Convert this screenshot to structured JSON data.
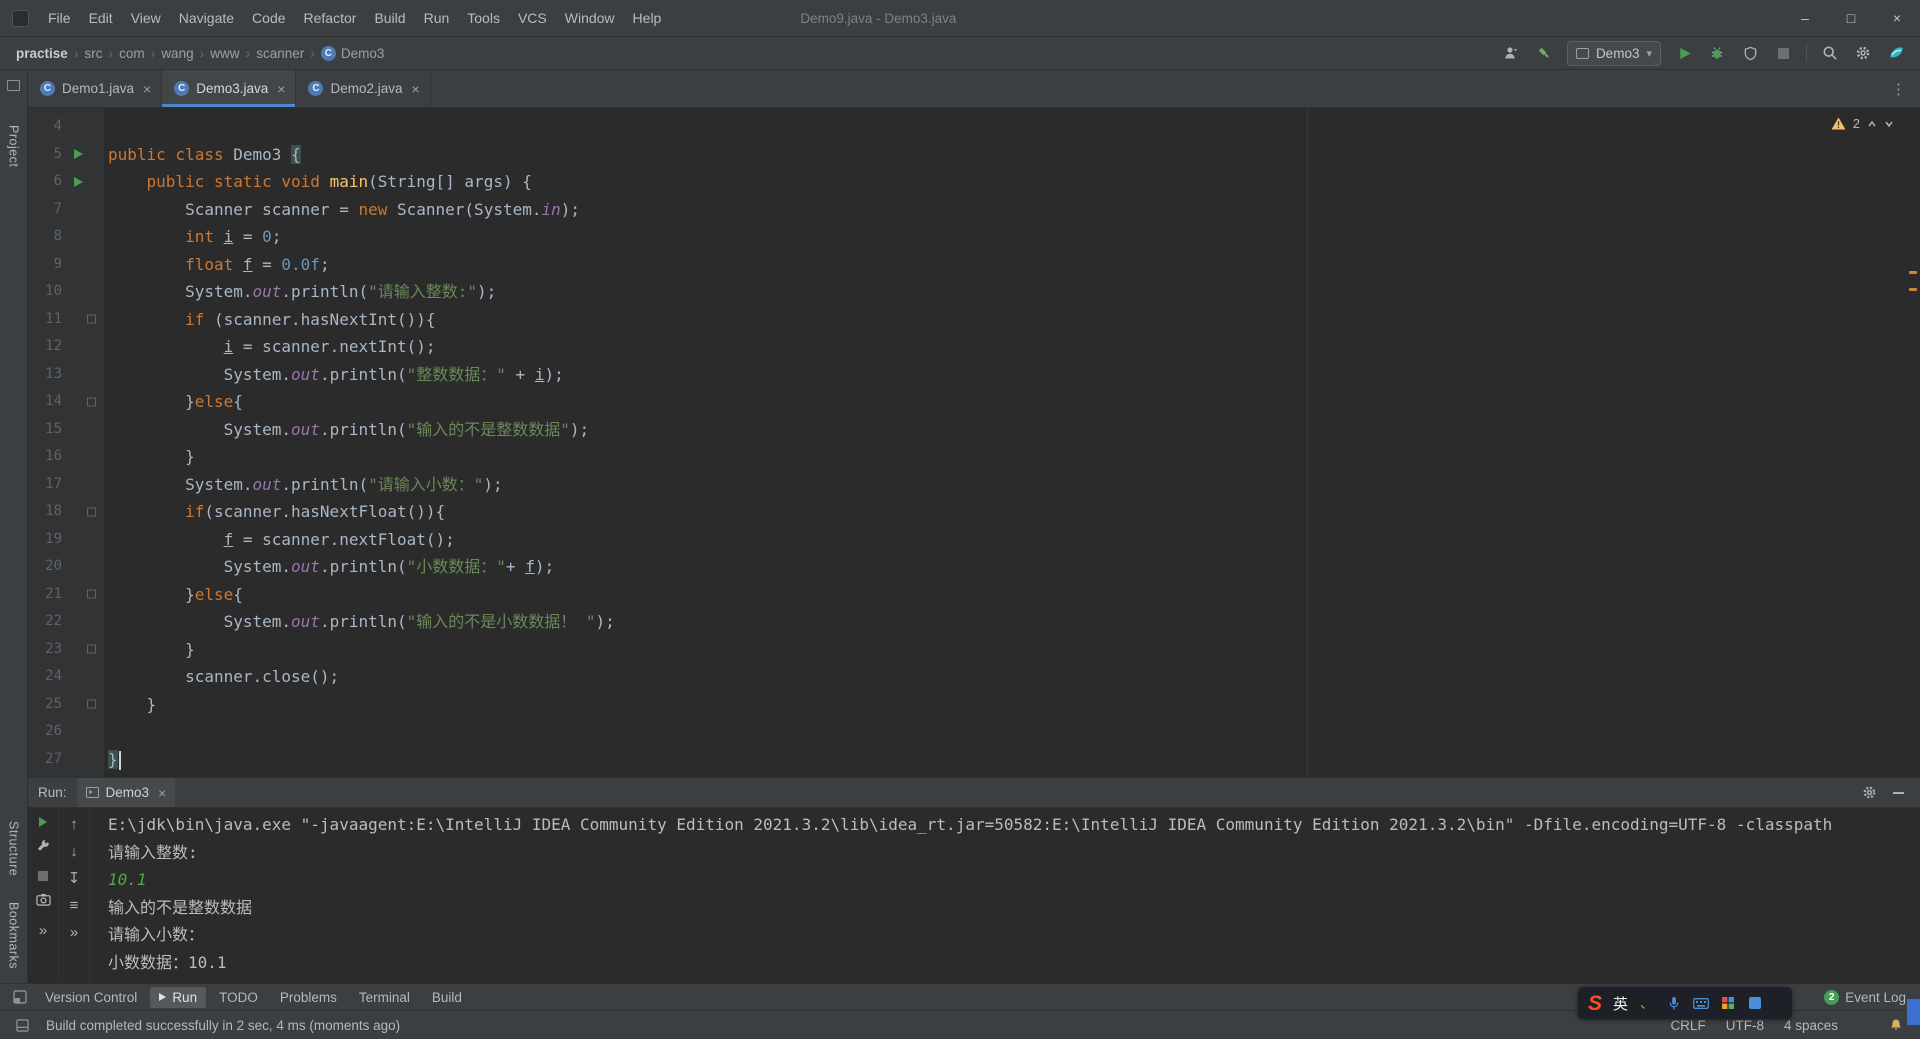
{
  "colors": {
    "accent_blue": "#4a88c7",
    "run_green": "#499c54",
    "keyword_orange": "#cc7832",
    "string_green": "#6a8759",
    "number_blue": "#6897bb",
    "field_purple": "#9876aa",
    "method_yellow": "#ffc66b",
    "warning_yellow": "#f2c55c",
    "console_input_green": "#4ca64c"
  },
  "icons": {
    "chevron": "›",
    "close": "×",
    "minimize": "–",
    "maximize": "□",
    "close_window": "×",
    "dropdown": "▾",
    "up": "↑",
    "down": "↓",
    "more": "»",
    "menu_lines": "≡",
    "scroll_end": "↧",
    "dots": "⋮"
  },
  "title_bar": {
    "title": "Demo9.java - Demo3.java",
    "menus": [
      "File",
      "Edit",
      "View",
      "Navigate",
      "Code",
      "Refactor",
      "Build",
      "Run",
      "Tools",
      "VCS",
      "Window",
      "Help"
    ]
  },
  "breadcrumbs": [
    "practise",
    "src",
    "com",
    "wang",
    "www",
    "scanner",
    "Demo3"
  ],
  "nav_toolbar": {
    "run_config": "Demo3"
  },
  "tabs": [
    {
      "label": "Demo1.java",
      "active": false
    },
    {
      "label": "Demo3.java",
      "active": true
    },
    {
      "label": "Demo2.java",
      "active": false
    }
  ],
  "stripe": {
    "top": [
      "Project"
    ],
    "bottom": [
      "Structure",
      "Bookmarks"
    ]
  },
  "editor": {
    "inspections": {
      "warnings": "2"
    },
    "lines": [
      {
        "num": "4",
        "segs": []
      },
      {
        "num": "5",
        "run": true,
        "segs": [
          [
            "k",
            "public class "
          ],
          [
            "p",
            "Demo3 "
          ],
          [
            "bh",
            "{"
          ]
        ]
      },
      {
        "num": "6",
        "run": true,
        "segs": [
          [
            "p",
            "    "
          ],
          [
            "k",
            "public static void "
          ],
          [
            "m",
            "main"
          ],
          [
            "p",
            "(String[] args) {"
          ]
        ]
      },
      {
        "num": "7",
        "segs": [
          [
            "p",
            "        Scanner scanner = "
          ],
          [
            "k",
            "new"
          ],
          [
            "p",
            " Scanner(System."
          ],
          [
            "f",
            "in"
          ],
          [
            "p",
            ");"
          ]
        ]
      },
      {
        "num": "8",
        "segs": [
          [
            "p",
            "        "
          ],
          [
            "k",
            "int "
          ],
          [
            "u",
            "i"
          ],
          [
            "p",
            " = "
          ],
          [
            "n",
            "0"
          ],
          [
            "p",
            ";"
          ]
        ]
      },
      {
        "num": "9",
        "segs": [
          [
            "p",
            "        "
          ],
          [
            "k",
            "float "
          ],
          [
            "u",
            "f"
          ],
          [
            "p",
            " = "
          ],
          [
            "n",
            "0.0f"
          ],
          [
            "p",
            ";"
          ]
        ]
      },
      {
        "num": "10",
        "segs": [
          [
            "p",
            "        System."
          ],
          [
            "f",
            "out"
          ],
          [
            "p",
            ".println("
          ],
          [
            "s",
            "\"请输入整数:\""
          ],
          [
            "p",
            ");"
          ]
        ]
      },
      {
        "num": "11",
        "fold": true,
        "segs": [
          [
            "p",
            "        "
          ],
          [
            "k",
            "if"
          ],
          [
            "p",
            " (scanner.hasNextInt()){"
          ]
        ]
      },
      {
        "num": "12",
        "segs": [
          [
            "p",
            "            "
          ],
          [
            "u",
            "i"
          ],
          [
            "p",
            " = scanner.nextInt();"
          ]
        ]
      },
      {
        "num": "13",
        "segs": [
          [
            "p",
            "            System."
          ],
          [
            "f",
            "out"
          ],
          [
            "p",
            ".println("
          ],
          [
            "s",
            "\"整数数据：\""
          ],
          [
            "p",
            " + "
          ],
          [
            "u",
            "i"
          ],
          [
            "p",
            ");"
          ]
        ]
      },
      {
        "num": "14",
        "fold": true,
        "segs": [
          [
            "p",
            "        }"
          ],
          [
            "k",
            "else"
          ],
          [
            "p",
            "{"
          ]
        ]
      },
      {
        "num": "15",
        "segs": [
          [
            "p",
            "            System."
          ],
          [
            "f",
            "out"
          ],
          [
            "p",
            ".println("
          ],
          [
            "s",
            "\"输入的不是整数数据\""
          ],
          [
            "p",
            ");"
          ]
        ]
      },
      {
        "num": "16",
        "segs": [
          [
            "p",
            "        }"
          ]
        ]
      },
      {
        "num": "17",
        "segs": [
          [
            "p",
            "        System."
          ],
          [
            "f",
            "out"
          ],
          [
            "p",
            ".println("
          ],
          [
            "s",
            "\"请输入小数：\""
          ],
          [
            "p",
            ");"
          ]
        ]
      },
      {
        "num": "18",
        "fold": true,
        "segs": [
          [
            "p",
            "        "
          ],
          [
            "k",
            "if"
          ],
          [
            "p",
            "(scanner.hasNextFloat()){"
          ]
        ]
      },
      {
        "num": "19",
        "segs": [
          [
            "p",
            "            "
          ],
          [
            "u",
            "f"
          ],
          [
            "p",
            " = scanner.nextFloat();"
          ]
        ]
      },
      {
        "num": "20",
        "segs": [
          [
            "p",
            "            System."
          ],
          [
            "f",
            "out"
          ],
          [
            "p",
            ".println("
          ],
          [
            "s",
            "\"小数数据：\""
          ],
          [
            "p",
            "+ "
          ],
          [
            "u",
            "f"
          ],
          [
            "p",
            ");"
          ]
        ]
      },
      {
        "num": "21",
        "fold": true,
        "segs": [
          [
            "p",
            "        }"
          ],
          [
            "k",
            "else"
          ],
          [
            "p",
            "{"
          ]
        ]
      },
      {
        "num": "22",
        "segs": [
          [
            "p",
            "            System."
          ],
          [
            "f",
            "out"
          ],
          [
            "p",
            ".println("
          ],
          [
            "s",
            "\"输入的不是小数数据！ \""
          ],
          [
            "p",
            ");"
          ]
        ]
      },
      {
        "num": "23",
        "fold": true,
        "segs": [
          [
            "p",
            "        }"
          ]
        ]
      },
      {
        "num": "24",
        "segs": [
          [
            "p",
            "        scanner.close();"
          ]
        ]
      },
      {
        "num": "25",
        "fold": true,
        "segs": [
          [
            "p",
            "    }"
          ]
        ]
      },
      {
        "num": "26",
        "segs": []
      },
      {
        "num": "27",
        "caret": true,
        "segs": [
          [
            "bh",
            "}"
          ]
        ]
      }
    ]
  },
  "run_panel": {
    "label": "Run:",
    "tab": "Demo3",
    "console": [
      [
        "sys",
        "E:\\jdk\\bin\\java.exe \"-javaagent:E:\\IntelliJ IDEA Community Edition 2021.3.2\\lib\\idea_rt.jar=50582:E:\\IntelliJ IDEA Community Edition 2021.3.2\\bin\" -Dfile.encoding=UTF-8 -classpath"
      ],
      [
        "out",
        "请输入整数:"
      ],
      [
        "in",
        "10.1"
      ],
      [
        "out",
        "输入的不是整数数据"
      ],
      [
        "out",
        "请输入小数："
      ],
      [
        "out",
        "小数数据：10.1"
      ]
    ]
  },
  "bottom_bar": {
    "items": [
      {
        "label": "Version Control",
        "active": false
      },
      {
        "label": "Run",
        "active": true
      },
      {
        "label": "TODO",
        "active": false
      },
      {
        "label": "Problems",
        "active": false
      },
      {
        "label": "Terminal",
        "active": false
      },
      {
        "label": "Build",
        "active": false
      }
    ],
    "event_log": {
      "label": "Event Log",
      "badge": "2"
    }
  },
  "status_bar": {
    "message": "Build completed successfully in 2 sec, 4 ms (moments ago)",
    "right": [
      "CRLF",
      "UTF-8",
      "4 spaces"
    ]
  },
  "ime": {
    "logo": "S",
    "mode": "英"
  }
}
